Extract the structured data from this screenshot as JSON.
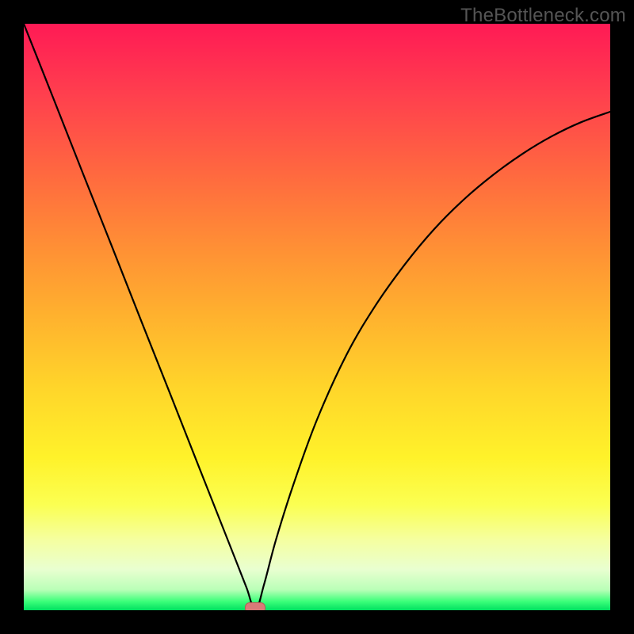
{
  "watermark": "TheBottleneck.com",
  "chart_data": {
    "type": "line",
    "title": "",
    "xlabel": "",
    "ylabel": "",
    "xlim": [
      0,
      1
    ],
    "ylim": [
      0,
      1
    ],
    "grid": false,
    "legend": false,
    "marker": {
      "x": 0.395,
      "y": 0.0,
      "color": "#d87a78"
    },
    "gradient_stops": [
      {
        "pos": 0.0,
        "color": "#ff1a55"
      },
      {
        "pos": 0.12,
        "color": "#ff3f4e"
      },
      {
        "pos": 0.26,
        "color": "#ff6a3f"
      },
      {
        "pos": 0.38,
        "color": "#ff8f35"
      },
      {
        "pos": 0.5,
        "color": "#ffb22e"
      },
      {
        "pos": 0.62,
        "color": "#ffd52a"
      },
      {
        "pos": 0.74,
        "color": "#fff22a"
      },
      {
        "pos": 0.82,
        "color": "#fbff52"
      },
      {
        "pos": 0.88,
        "color": "#f5ffa0"
      },
      {
        "pos": 0.93,
        "color": "#e9ffd0"
      },
      {
        "pos": 0.965,
        "color": "#baffb8"
      },
      {
        "pos": 0.985,
        "color": "#3cff7a"
      },
      {
        "pos": 1.0,
        "color": "#00e060"
      }
    ],
    "series": [
      {
        "name": "bottleneck-curve",
        "color": "#000000",
        "x": [
          0.0,
          0.05,
          0.1,
          0.15,
          0.2,
          0.25,
          0.3,
          0.33,
          0.36,
          0.38,
          0.395,
          0.41,
          0.43,
          0.46,
          0.5,
          0.55,
          0.6,
          0.65,
          0.7,
          0.75,
          0.8,
          0.85,
          0.9,
          0.95,
          1.0
        ],
        "y": [
          1.0,
          0.874,
          0.747,
          0.621,
          0.494,
          0.368,
          0.241,
          0.165,
          0.089,
          0.038,
          0.0,
          0.045,
          0.12,
          0.215,
          0.325,
          0.435,
          0.52,
          0.59,
          0.65,
          0.7,
          0.742,
          0.778,
          0.808,
          0.832,
          0.85
        ]
      }
    ]
  }
}
